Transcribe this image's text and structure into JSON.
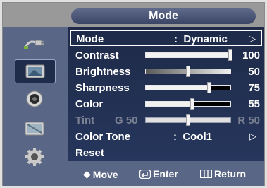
{
  "title": "Mode",
  "sidebar": {
    "icons": [
      {
        "name": "input-plug-icon"
      },
      {
        "name": "picture-icon",
        "active": true
      },
      {
        "name": "sound-icon"
      },
      {
        "name": "channel-icon"
      },
      {
        "name": "setup-gear-icon"
      }
    ]
  },
  "menu": {
    "mode": {
      "label": "Mode",
      "separator": ":",
      "value": "Dynamic",
      "arrow": "▷"
    },
    "contrast": {
      "label": "Contrast",
      "value": "100",
      "level": 1.0
    },
    "brightness": {
      "label": "Brightness",
      "value": "50",
      "level": 0.5
    },
    "sharpness": {
      "label": "Sharpness",
      "value": "75",
      "level": 0.75
    },
    "color": {
      "label": "Color",
      "value": "55",
      "level": 0.55
    },
    "tint": {
      "label": "Tint",
      "left": "G 50",
      "right": "R 50",
      "level": 0.5
    },
    "color_tone": {
      "label": "Color Tone",
      "separator": ":",
      "value": "Cool1",
      "arrow": "▷"
    },
    "reset": {
      "label": "Reset"
    }
  },
  "hints": {
    "move": {
      "icon": "◆",
      "label": "Move"
    },
    "enter": {
      "label": "Enter"
    },
    "return": {
      "label": "Return"
    }
  }
}
